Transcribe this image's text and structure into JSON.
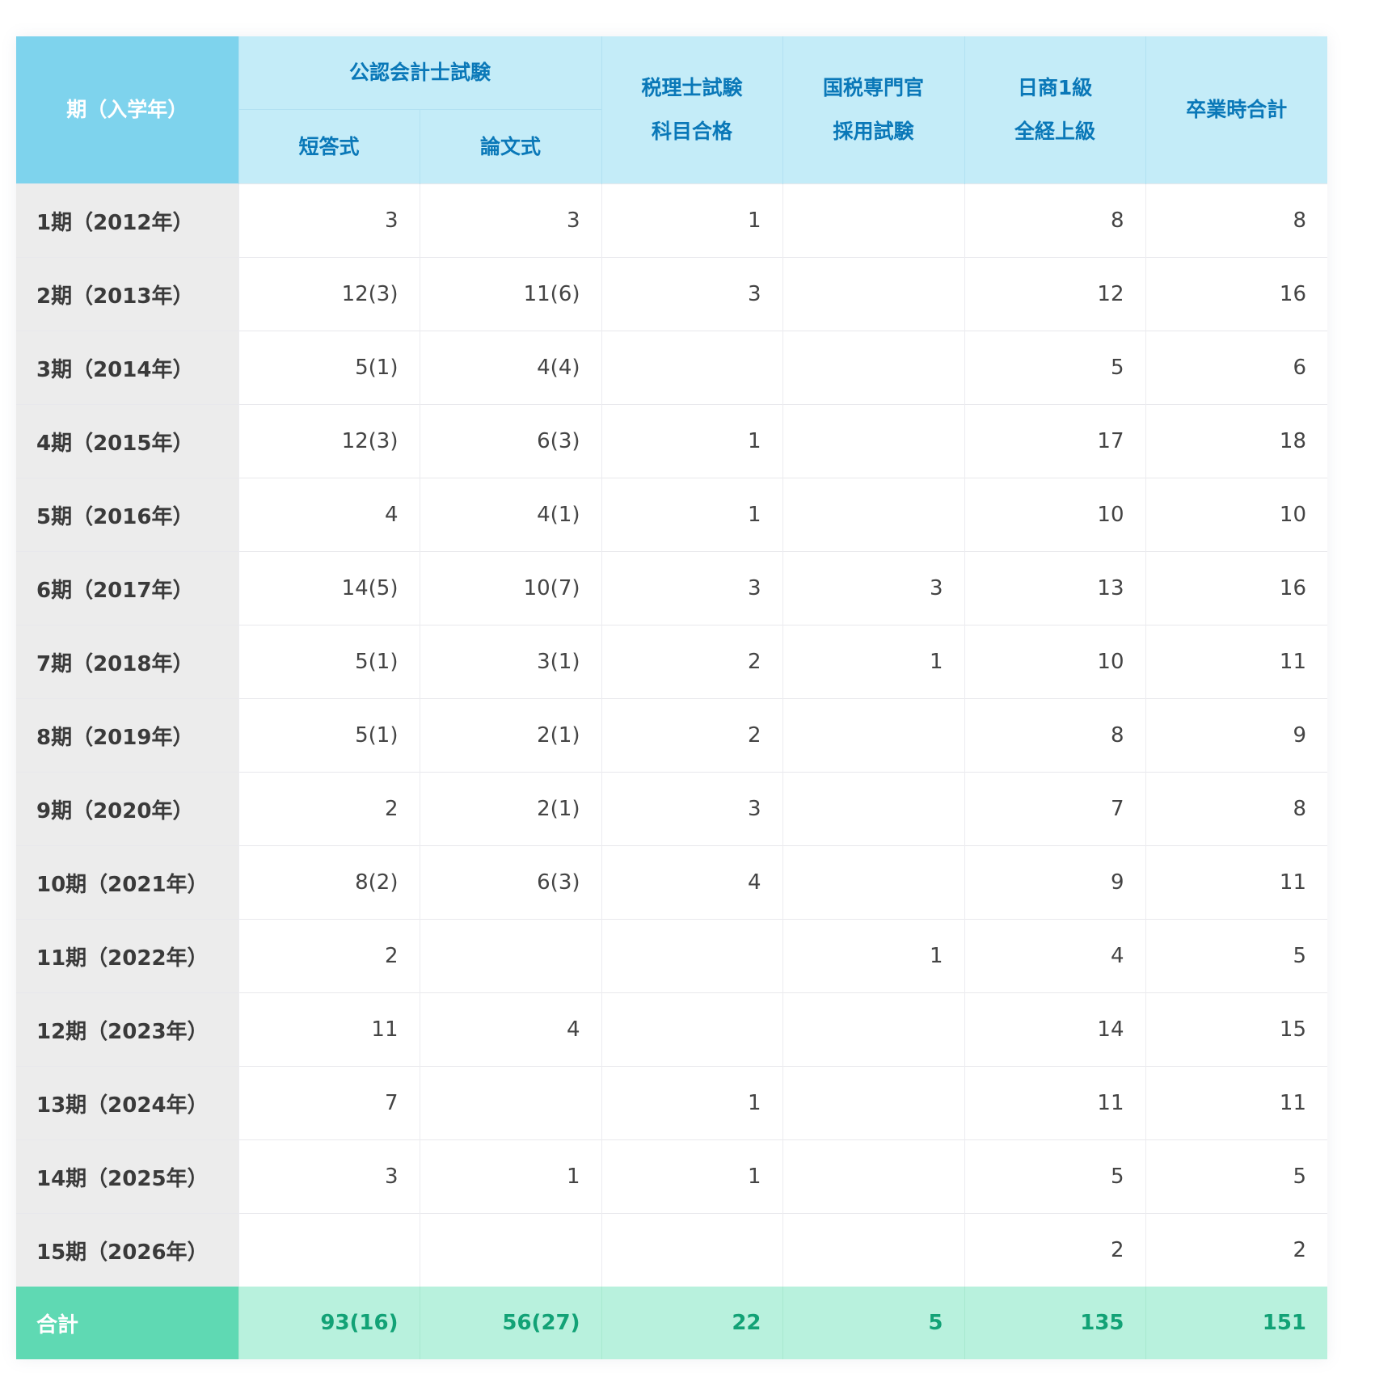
{
  "headers": {
    "period": "期（入学年）",
    "cpa_group": "公認会計士試験",
    "cpa_short": "短答式",
    "cpa_essay": "論文式",
    "tax_line1": "税理士試験",
    "tax_line2": "科目合格",
    "ntax_line1": "国税専門官",
    "ntax_line2": "採用試験",
    "nissho_line1": "日商1級",
    "nissho_line2": "全経上級",
    "total": "卒業時合計"
  },
  "rows": [
    {
      "label": "1期（2012年）",
      "cpa_short": "3",
      "cpa_essay": "3",
      "tax": "1",
      "ntax": "",
      "nissho": "8",
      "total": "8"
    },
    {
      "label": "2期（2013年）",
      "cpa_short": "12(3)",
      "cpa_essay": "11(6)",
      "tax": "3",
      "ntax": "",
      "nissho": "12",
      "total": "16"
    },
    {
      "label": "3期（2014年）",
      "cpa_short": "5(1)",
      "cpa_essay": "4(4)",
      "tax": "",
      "ntax": "",
      "nissho": "5",
      "total": "6"
    },
    {
      "label": "4期（2015年）",
      "cpa_short": "12(3)",
      "cpa_essay": "6(3)",
      "tax": "1",
      "ntax": "",
      "nissho": "17",
      "total": "18"
    },
    {
      "label": "5期（2016年）",
      "cpa_short": "4",
      "cpa_essay": "4(1)",
      "tax": "1",
      "ntax": "",
      "nissho": "10",
      "total": "10"
    },
    {
      "label": "6期（2017年）",
      "cpa_short": "14(5)",
      "cpa_essay": "10(7)",
      "tax": "3",
      "ntax": "3",
      "nissho": "13",
      "total": "16"
    },
    {
      "label": "7期（2018年）",
      "cpa_short": "5(1)",
      "cpa_essay": "3(1)",
      "tax": "2",
      "ntax": "1",
      "nissho": "10",
      "total": "11"
    },
    {
      "label": "8期（2019年）",
      "cpa_short": "5(1)",
      "cpa_essay": "2(1)",
      "tax": "2",
      "ntax": "",
      "nissho": "8",
      "total": "9"
    },
    {
      "label": "9期（2020年）",
      "cpa_short": "2",
      "cpa_essay": "2(1)",
      "tax": "3",
      "ntax": "",
      "nissho": "7",
      "total": "8"
    },
    {
      "label": "10期（2021年）",
      "cpa_short": "8(2)",
      "cpa_essay": "6(3)",
      "tax": "4",
      "ntax": "",
      "nissho": "9",
      "total": "11"
    },
    {
      "label": "11期（2022年）",
      "cpa_short": "2",
      "cpa_essay": "",
      "tax": "",
      "ntax": "1",
      "nissho": "4",
      "total": "5"
    },
    {
      "label": "12期（2023年）",
      "cpa_short": "11",
      "cpa_essay": "4",
      "tax": "",
      "ntax": "",
      "nissho": "14",
      "total": "15"
    },
    {
      "label": "13期（2024年）",
      "cpa_short": "7",
      "cpa_essay": "",
      "tax": "1",
      "ntax": "",
      "nissho": "11",
      "total": "11"
    },
    {
      "label": "14期（2025年）",
      "cpa_short": "3",
      "cpa_essay": "1",
      "tax": "1",
      "ntax": "",
      "nissho": "5",
      "total": "5"
    },
    {
      "label": "15期（2026年）",
      "cpa_short": "",
      "cpa_essay": "",
      "tax": "",
      "ntax": "",
      "nissho": "2",
      "total": "2"
    }
  ],
  "total_row": {
    "label": "合計",
    "cpa_short": "93(16)",
    "cpa_essay": "56(27)",
    "tax": "22",
    "ntax": "5",
    "nissho": "135",
    "total": "151"
  },
  "colors": {
    "header_bg": "#c4ecf8",
    "header_corner_bg": "#7ed3ed",
    "header_text": "#0a78b8",
    "row_label_bg": "#ececec",
    "total_bg": "#b8f1dd",
    "total_label_bg": "#5fd9b3",
    "total_text": "#12a276"
  }
}
